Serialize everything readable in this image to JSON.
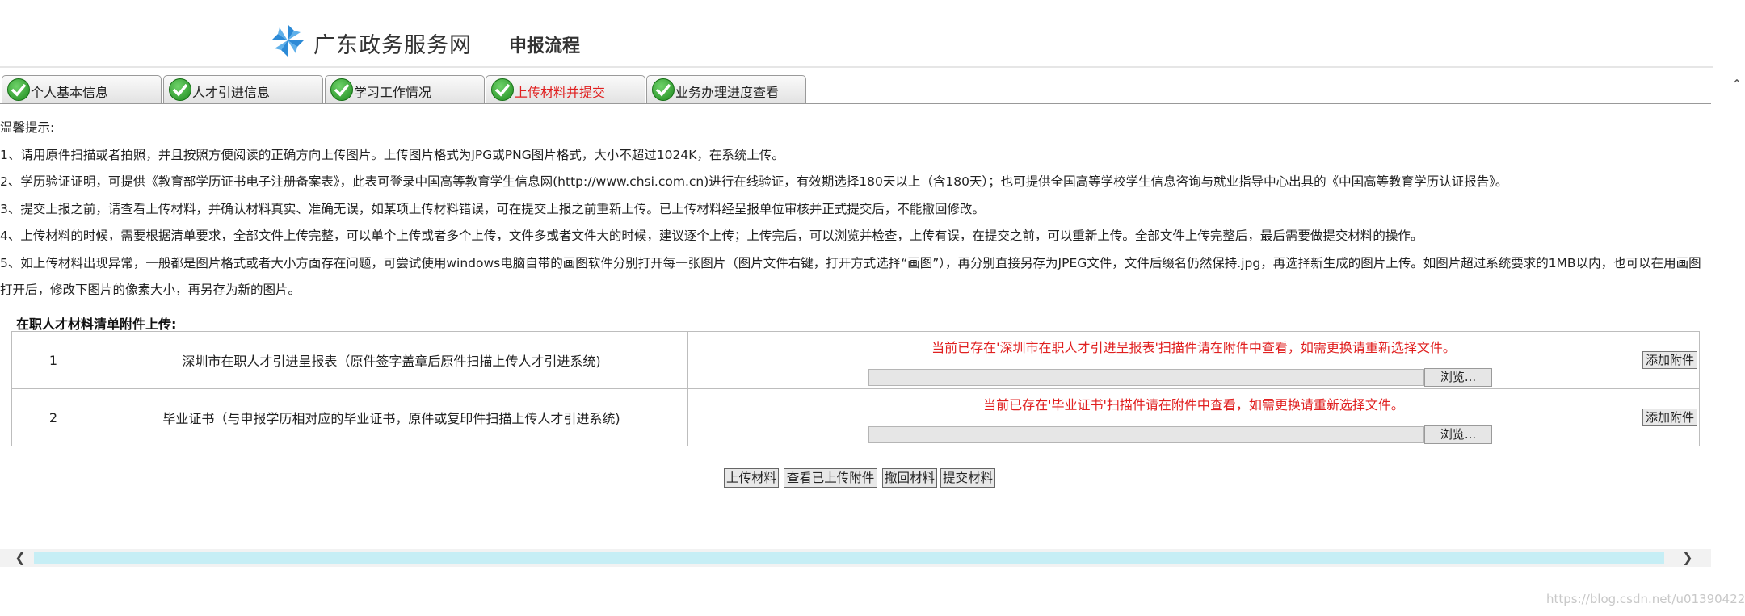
{
  "header": {
    "site_name": "广东政务服务网",
    "flow_title": "申报流程",
    "logo_icon": "pinwheel-logo-icon",
    "brand_color": "#2c8ad6"
  },
  "tabs": [
    {
      "label": "个人基本信息",
      "icon": "check-icon",
      "active": false
    },
    {
      "label": "人才引进信息",
      "icon": "check-icon",
      "active": false
    },
    {
      "label": "学习工作情况",
      "icon": "check-icon",
      "active": false
    },
    {
      "label": "上传材料并提交",
      "icon": "check-icon",
      "active": true
    },
    {
      "label": "业务办理进度查看",
      "icon": "check-icon",
      "active": false
    }
  ],
  "tips": {
    "heading": "温馨提示:",
    "lines": [
      "1、请用原件扫描或者拍照，并且按照方便阅读的正确方向上传图片。上传图片格式为JPG或PNG图片格式，大小不超过1024K，在系统上传。",
      "2、学历验证证明，可提供《教育部学历证书电子注册备案表》，此表可登录中国高等教育学生信息网(http://www.chsi.com.cn)进行在线验证，有效期选择180天以上（含180天）；也可提供全国高等学校学生信息咨询与就业指导中心出具的《中国高等教育学历认证报告》。",
      "3、提交上报之前，请查看上传材料，并确认材料真实、准确无误，如某项上传材料错误，可在提交上报之前重新上传。已上传材料经呈报单位审核并正式提交后，不能撤回修改。",
      "4、上传材料的时候，需要根据清单要求，全部文件上传完整，可以单个上传或者多个上传，文件多或者文件大的时候，建议逐个上传；上传完后，可以浏览并检查，上传有误，在提交之前，可以重新上传。全部文件上传完整后，最后需要做提交材料的操作。",
      "5、如上传材料出现异常，一般都是图片格式或者大小方面存在问题，可尝试使用windows电脑自带的画图软件分别打开每一张图片（图片文件右键，打开方式选择“画图”），再分别直接另存为JPEG文件，文件后缀名仍然保持.jpg，再选择新生成的图片上传。如图片超过系统要求的1MB以内，也可以在用画图打开后，修改下图片的像素大小，再另存为新的图片。"
    ]
  },
  "materials": {
    "section_title": "在职人才材料清单附件上传:",
    "browse_label": "浏览...",
    "add_label": "添加附件",
    "rows": [
      {
        "no": "1",
        "name": "深圳市在职人才引进呈报表（原件签字盖章后原件扫描上传人才引进系统)",
        "notice": "当前已存在'深圳市在职人才引进呈报表'扫描件请在附件中查看，如需更换请重新选择文件。"
      },
      {
        "no": "2",
        "name": "毕业证书（与申报学历相对应的毕业证书，原件或复印件扫描上传人才引进系统)",
        "notice": "当前已存在'毕业证书'扫描件请在附件中查看，如需更换请重新选择文件。"
      }
    ]
  },
  "actions": {
    "upload": "上传材料",
    "view_uploaded": "查看已上传附件",
    "withdraw": "撤回材料",
    "submit": "提交材料"
  },
  "scrollbar": {
    "left_icon": "chevron-left-icon",
    "right_icon": "chevron-right-icon",
    "up_icon": "chevron-up-icon"
  },
  "watermark": "https://blog.csdn.net/u013904227",
  "colors": {
    "alert_red": "#e02020",
    "check_green": "#1e8a1e",
    "scroll_thumb": "#c6eef5"
  }
}
